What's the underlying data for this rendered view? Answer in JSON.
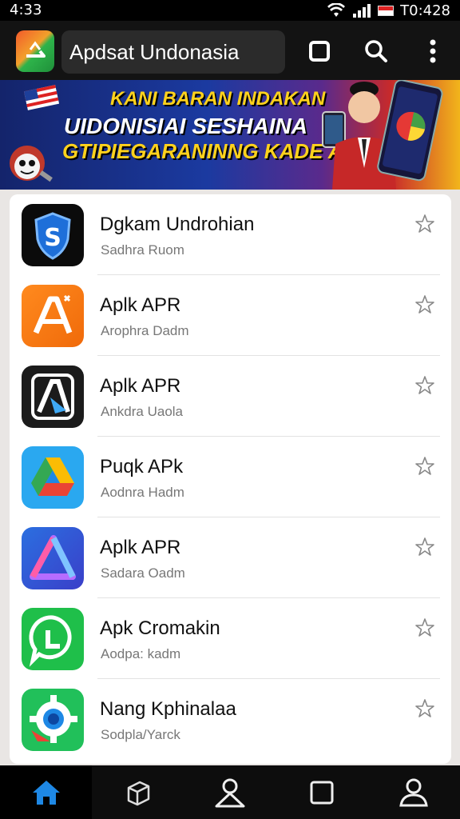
{
  "status_bar": {
    "time": "4:33",
    "clock": "T0:428"
  },
  "app_bar": {
    "search_text": "Apdsat Undonasia"
  },
  "banner": {
    "line1": "KANI BARAN INDAKAN",
    "line2": "UIDONISIAI SESHAINA",
    "line3": "GTIPIEGARANINNG KADE APK"
  },
  "apps": [
    {
      "title": "Dgkam Undrohian",
      "subtitle": "Sadhra Ruom",
      "icon": "shield-s-icon"
    },
    {
      "title": "Aplk APR",
      "subtitle": "Arophra Dadm",
      "icon": "letter-a-icon"
    },
    {
      "title": "Aplk APR",
      "subtitle": "Ankdra Uaola",
      "icon": "a-phone-icon"
    },
    {
      "title": "Puqk APk",
      "subtitle": "Aodnra Hadm",
      "icon": "drive-icon"
    },
    {
      "title": "Aplk APR",
      "subtitle": "Sadara Oadm",
      "icon": "gradient-a-icon"
    },
    {
      "title": "Apk Cromakin",
      "subtitle": "Aodpa: kadm",
      "icon": "chat-l-icon"
    },
    {
      "title": "Nang Kphinalaa",
      "subtitle": "Sodpla/Yarck",
      "icon": "gear-icon"
    }
  ],
  "nav": [
    {
      "name": "home",
      "icon": "home-icon"
    },
    {
      "name": "apps",
      "icon": "box-icon"
    },
    {
      "name": "profile",
      "icon": "person-outline-icon"
    },
    {
      "name": "tabs",
      "icon": "square-icon"
    },
    {
      "name": "account",
      "icon": "person-icon"
    }
  ],
  "colors": {
    "accent": "#1e88e5",
    "app_bar": "#131313",
    "card": "#ffffff"
  }
}
